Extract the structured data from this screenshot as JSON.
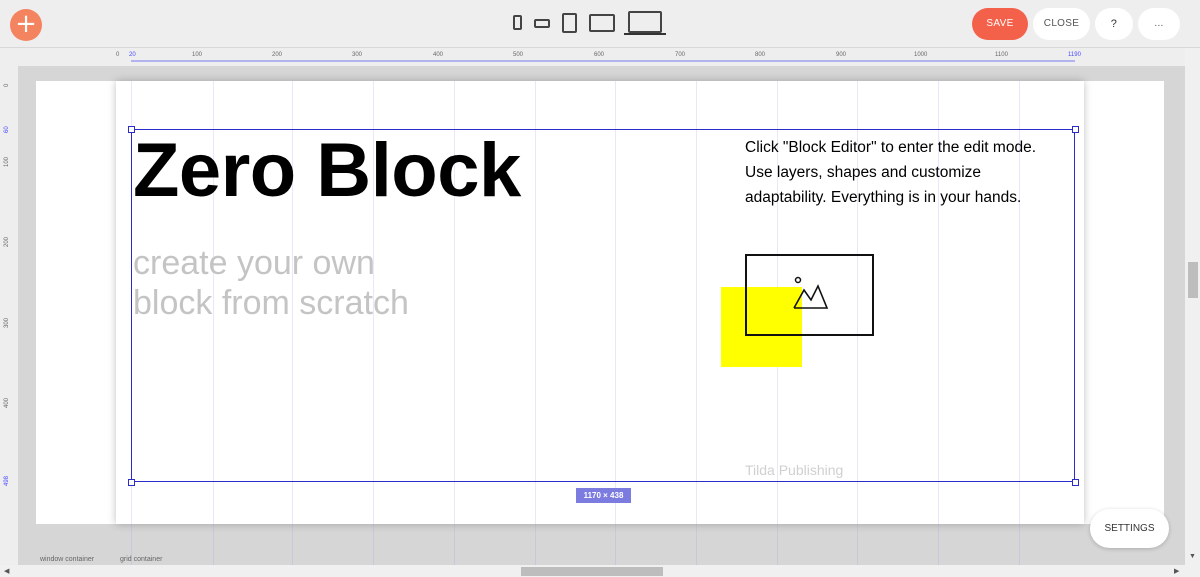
{
  "toolbar": {
    "add_label": "+",
    "save_label": "SAVE",
    "close_label": "CLOSE",
    "help_label": "?",
    "more_label": "..."
  },
  "devices": [
    "mobile-portrait",
    "mobile-landscape",
    "tablet-portrait",
    "tablet-landscape",
    "desktop"
  ],
  "ruler": {
    "h_start": "0",
    "h_marker": "20",
    "h_end": "1190",
    "h_ticks": [
      "100",
      "200",
      "300",
      "400",
      "500",
      "600",
      "700",
      "800",
      "900",
      "1000",
      "1100"
    ],
    "v_start": "0",
    "v_marker": "60",
    "v_end": "498",
    "v_ticks": [
      "100",
      "200",
      "300",
      "400"
    ]
  },
  "block": {
    "title": "Zero Block",
    "subtitle": "create your own block from scratch",
    "description": "Click \"Block Editor\" to enter the edit mode. Use layers, shapes and customize adaptability. Everything is in your hands.",
    "footer_text": "Tilda Publishing",
    "size_badge": "1170 × 438"
  },
  "settings_label": "SETTINGS",
  "labels": {
    "window_container": "window container",
    "grid_container": "grid container"
  },
  "colors": {
    "save": "#f4614a",
    "add": "#f4845f",
    "selection": "#2c2cc8",
    "shape": "#ffff00"
  },
  "icons": [
    "plus-icon",
    "image-icon",
    "arrow-left-icon",
    "arrow-right-icon",
    "arrow-down-icon"
  ]
}
